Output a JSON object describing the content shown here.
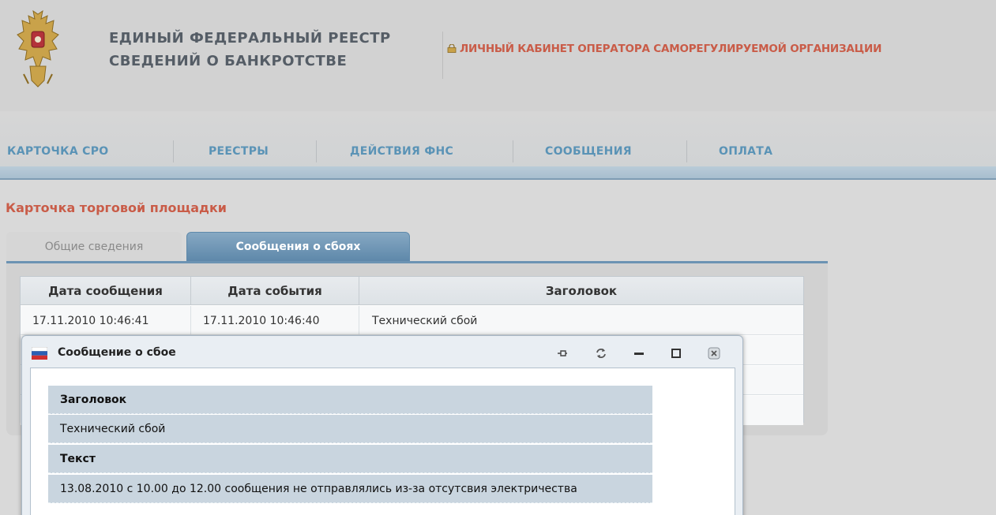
{
  "header": {
    "title_line1": "ЕДИНЫЙ ФЕДЕРАЛЬНЫЙ РЕЕСТР",
    "title_line2": "СВЕДЕНИЙ О БАНКРОТСТВЕ",
    "cabinet_label": "ЛИЧНЫЙ КАБИНЕТ ОПЕРАТОРА САМОРЕГУЛИРУЕМОЙ ОРГАНИЗАЦИИ",
    "emblem_icon": "coat-of-arms-icon",
    "lock_icon": "lock-icon"
  },
  "nav": {
    "items": [
      {
        "label": "КАРТОЧКА СРО"
      },
      {
        "label": "РЕЕСТРЫ"
      },
      {
        "label": "ДЕЙСТВИЯ ФНС"
      },
      {
        "label": "СООБЩЕНИЯ"
      },
      {
        "label": "ОПЛАТА"
      }
    ]
  },
  "page": {
    "title": "Карточка торговой площадки",
    "tabs": [
      {
        "label": "Общие сведения",
        "active": false
      },
      {
        "label": "Сообщения о сбоях",
        "active": true
      }
    ]
  },
  "grid": {
    "columns": [
      "Дата сообщения",
      "Дата события",
      "Заголовок"
    ],
    "rows": [
      [
        "17.11.2010 10:46:41",
        "17.11.2010 10:46:40",
        "Технический сбой"
      ]
    ]
  },
  "modal": {
    "title": "Сообщение о сбое",
    "window_icon": "flag-icon",
    "buttons": [
      "pin-icon",
      "refresh-icon",
      "minimize-icon",
      "maximize-icon",
      "close-icon"
    ],
    "fields": [
      {
        "label": "Заголовок",
        "value": "Технический сбой"
      },
      {
        "label": "Текст",
        "value": "13.08.2010 с 10.00 до 12.00 сообщения не отправлялись из-за отсутсвия электричества"
      }
    ]
  },
  "colors": {
    "accent_red": "#c95c48",
    "nav_blue": "#5a93b6",
    "tab_active": "#6c93b3"
  }
}
